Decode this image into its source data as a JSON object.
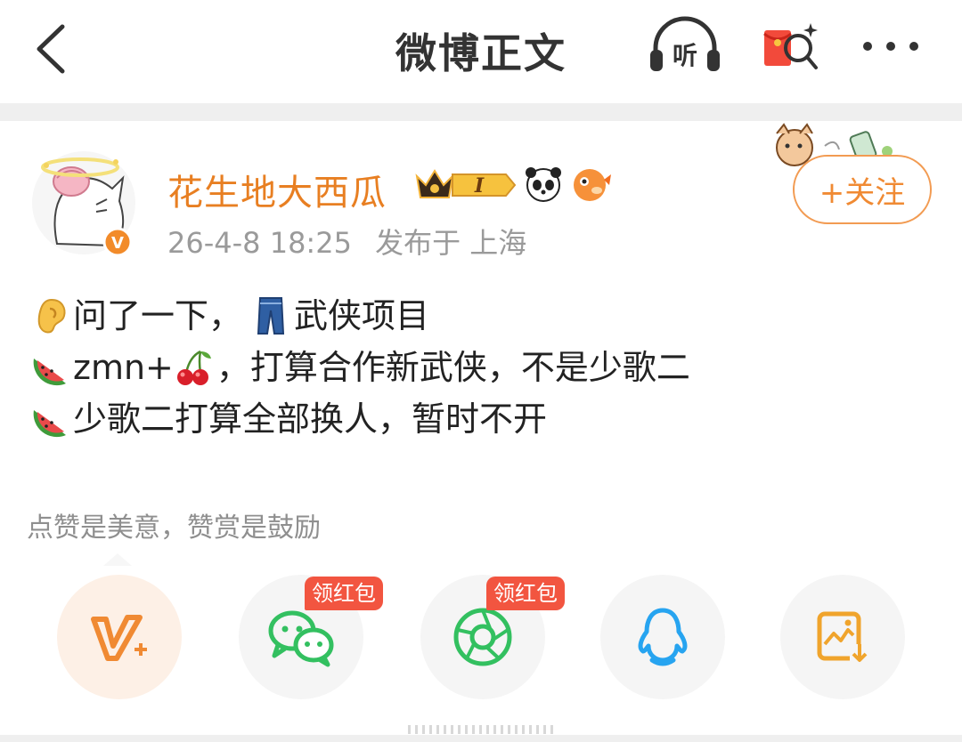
{
  "header": {
    "title": "微博正文",
    "listen_label": "听",
    "back_icon": "back-arrow-icon",
    "more_icon": "more-dots-icon"
  },
  "post": {
    "user": {
      "name": "花生地大西瓜",
      "verified": true,
      "badges": [
        "crown-level-badge",
        "panda-badge",
        "pufferfish-badge"
      ],
      "level": "I"
    },
    "timestamp": "26-4-8 18:25",
    "location": "发布于 上海",
    "follow_label": "+关注",
    "lines": [
      {
        "emoji": "ear-emoji",
        "text": "问了一下，"
      },
      {
        "emoji": "jeans-emoji",
        "text": "武侠项目"
      },
      {
        "emoji": "watermelon-emoji",
        "text": "zmn+"
      },
      {
        "emoji": "cherries-emoji",
        "text": "，打算合作新武侠，不是少歌二"
      },
      {
        "emoji": "watermelon-emoji",
        "text": "少歌二打算全部换人，暂时不开"
      }
    ]
  },
  "reward": {
    "hint": "点赞是美意，赞赏是鼓励"
  },
  "share": {
    "items": [
      {
        "name": "vplus",
        "tag": ""
      },
      {
        "name": "wechat",
        "tag": "领红包"
      },
      {
        "name": "moments",
        "tag": "领红包"
      },
      {
        "name": "qq",
        "tag": ""
      },
      {
        "name": "save-image",
        "tag": ""
      }
    ]
  },
  "colors": {
    "brand_orange": "#f08a33",
    "username": "#e87f22",
    "red_tag": "#f25540",
    "wechat_green": "#33c060",
    "qq_blue": "#27a4f0"
  }
}
